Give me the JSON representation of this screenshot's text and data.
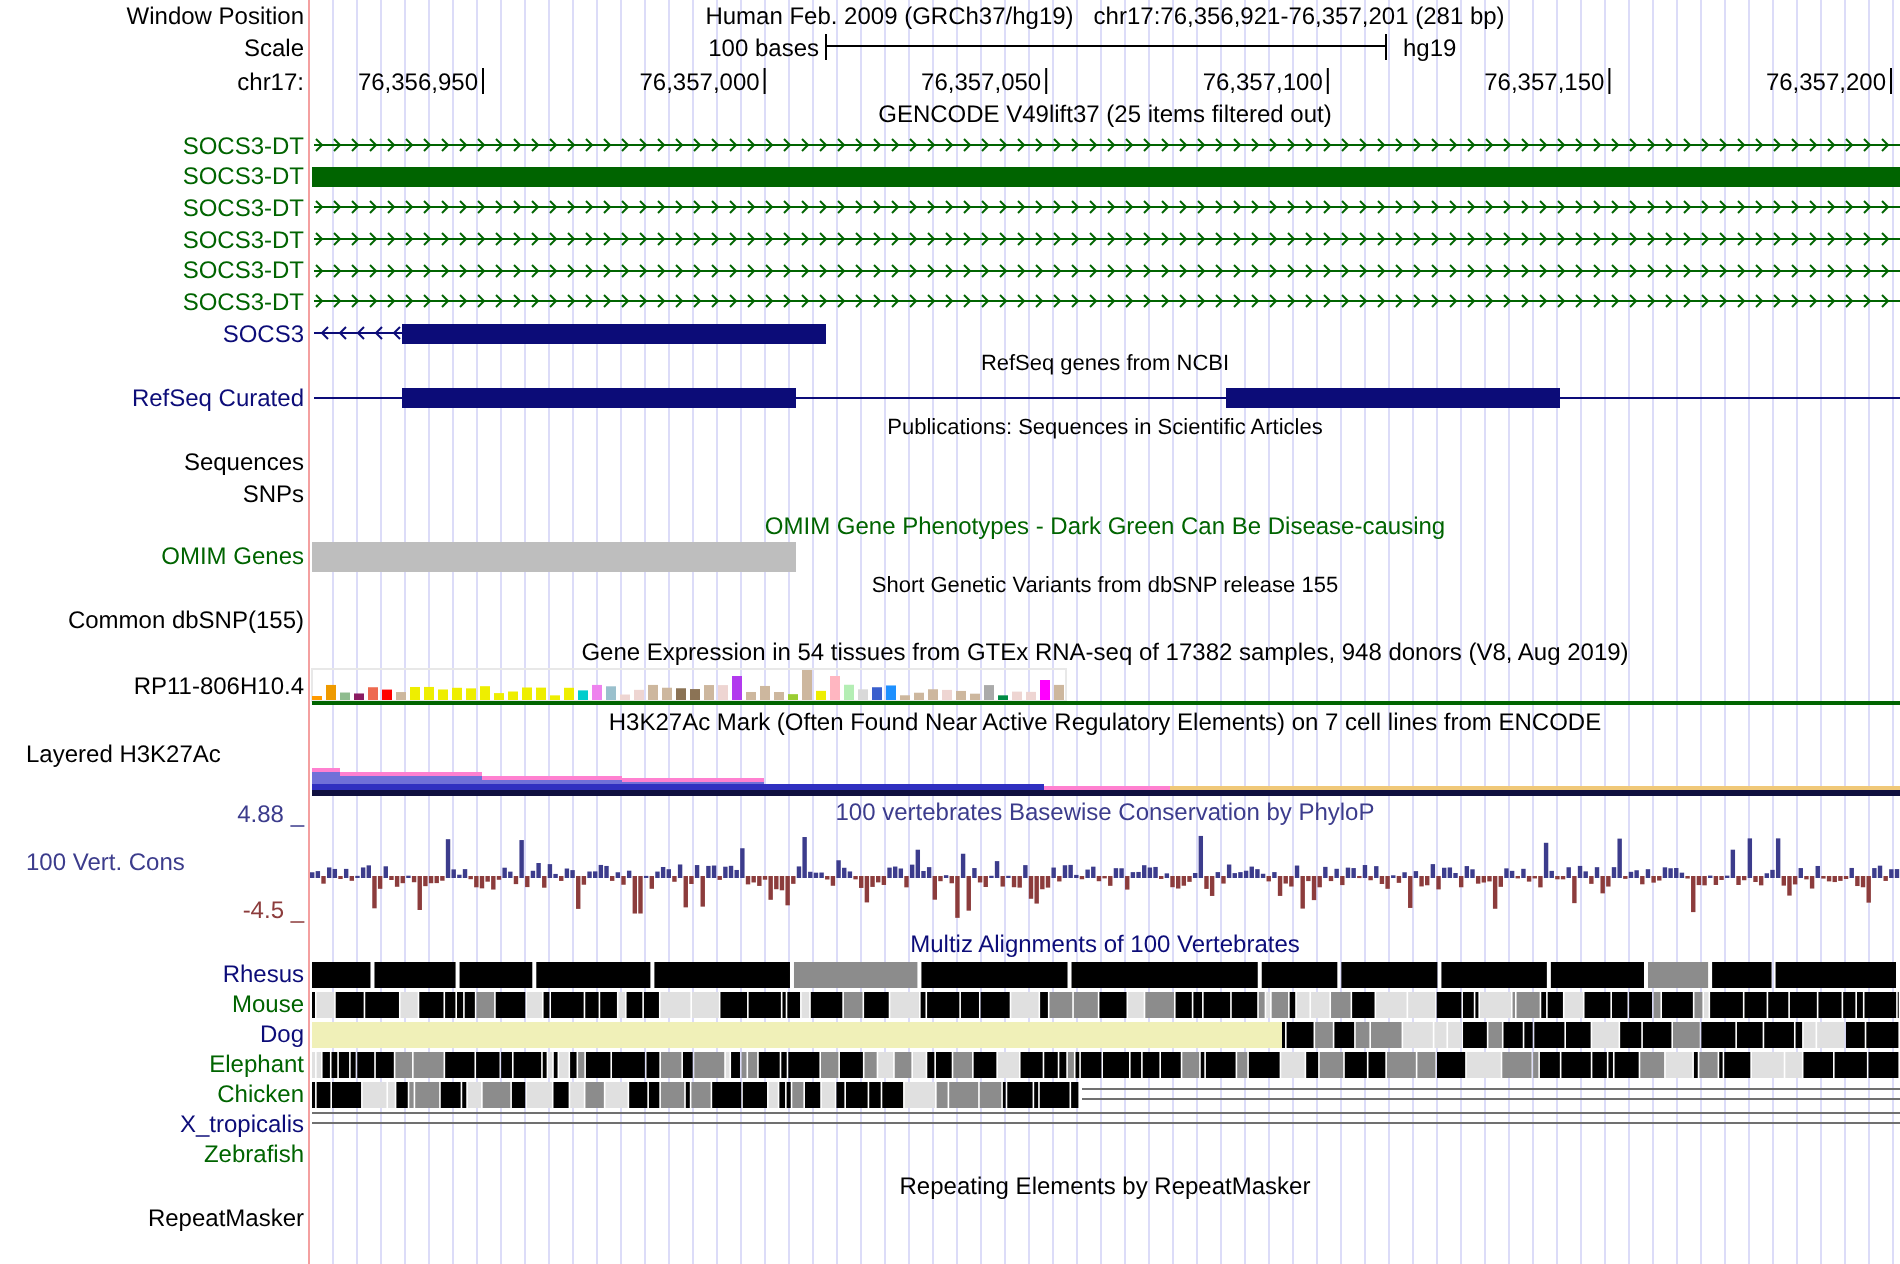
{
  "window_position": {
    "label": "Window Position",
    "assembly": "Human Feb. 2009 (GRCh37/hg19)",
    "position": "chr17:76,356,921-76,357,201 (281 bp)"
  },
  "scale": {
    "label": "Scale",
    "length": "100 bases",
    "assembly": "hg19"
  },
  "ruler": {
    "label": "chr17:",
    "ticks": [
      "76,356,950",
      "76,357,000",
      "76,357,050",
      "76,357,100",
      "76,357,150",
      "76,357,200"
    ]
  },
  "tracks": [
    {
      "kind": "title",
      "text": "GENCODE V49lift37 (25 items filtered out)",
      "color": "#000000"
    },
    {
      "kind": "gene-arrows",
      "label": "SOCS3-DT",
      "color": "#006400"
    },
    {
      "kind": "gene-thick",
      "label": "SOCS3-DT",
      "color": "#006400"
    },
    {
      "kind": "gene-arrows",
      "label": "SOCS3-DT",
      "color": "#006400"
    },
    {
      "kind": "gene-arrows",
      "label": "SOCS3-DT",
      "color": "#006400"
    },
    {
      "kind": "gene-arrows",
      "label": "SOCS3-DT",
      "color": "#006400"
    },
    {
      "kind": "gene-arrows",
      "label": "SOCS3-DT",
      "color": "#006400"
    },
    {
      "kind": "gene-reverse",
      "label": "SOCS3",
      "color": "#0c0c78"
    },
    {
      "kind": "small-title",
      "text": "RefSeq genes from NCBI",
      "color": "#000000"
    },
    {
      "kind": "refseq",
      "label": "RefSeq Curated",
      "color": "#0c0c78"
    },
    {
      "kind": "small-title",
      "text": "Publications: Sequences in Scientific Articles",
      "color": "#000000"
    },
    {
      "kind": "label",
      "label": "Sequences",
      "color": "#000000"
    },
    {
      "kind": "label",
      "label": "SNPs",
      "color": "#000000"
    },
    {
      "kind": "title",
      "text": "OMIM Gene Phenotypes - Dark Green Can Be Disease-causing",
      "color": "#006400"
    },
    {
      "kind": "bar",
      "label": "OMIM Genes",
      "color": "#006400"
    },
    {
      "kind": "small-title",
      "text": "Short Genetic Variants from dbSNP release 155",
      "color": "#000000"
    },
    {
      "kind": "label",
      "label": "Common dbSNP(155)",
      "color": "#000000"
    },
    {
      "kind": "title",
      "text": "Gene Expression in 54 tissues from GTEx RNA-seq of 17382 samples, 948 donors (V8, Aug 2019)",
      "color": "#000000"
    },
    {
      "kind": "expression",
      "label": "RP11-806H10.4",
      "color": "#000000"
    },
    {
      "kind": "title",
      "text": "H3K27Ac Mark (Often Found Near Active Regulatory Elements) on 7 cell lines from ENCODE",
      "color": "#000000"
    },
    {
      "kind": "layered",
      "label": "Layered H3K27Ac",
      "color": "#000000"
    },
    {
      "kind": "conservation",
      "label": "100 Vert. Cons",
      "title": "100 vertebrates Basewise Conservation by PhyloP",
      "max": "4.88 _",
      "min": "-4.5 _",
      "color": "#3c3c8c"
    },
    {
      "kind": "title",
      "text": "Multiz Alignments of 100 Vertebrates",
      "color": "#0c0c78"
    },
    {
      "kind": "species-solid",
      "label": "Rhesus",
      "color": "#0c0c78"
    },
    {
      "kind": "species-mixed",
      "label": "Mouse",
      "color": "#006400"
    },
    {
      "kind": "species-partial",
      "label": "Dog",
      "color": "#0c0c78"
    },
    {
      "kind": "species-mixed",
      "label": "Elephant",
      "color": "#006400"
    },
    {
      "kind": "species-ending",
      "label": "Chicken",
      "color": "#006400"
    },
    {
      "kind": "species-lines",
      "label": "X_tropicalis",
      "color": "#0c0c78"
    },
    {
      "kind": "species-empty",
      "label": "Zebrafish",
      "color": "#006400"
    },
    {
      "kind": "title",
      "text": "Repeating Elements by RepeatMasker",
      "color": "#000000"
    },
    {
      "kind": "label",
      "label": "RepeatMasker",
      "color": "#000000"
    }
  ]
}
